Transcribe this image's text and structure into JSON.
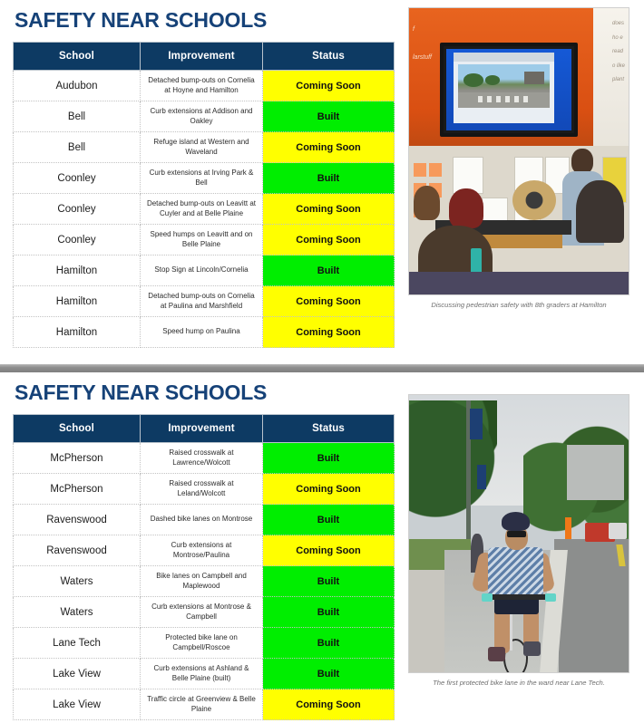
{
  "sections": [
    {
      "title": "SAFETY NEAR SCHOOLS",
      "columns": [
        "School",
        "Improvement",
        "Status"
      ],
      "rows": [
        {
          "school": "Audubon",
          "improvement": "Detached bump-outs on Cornelia at Hoyne and Hamilton",
          "status": "Coming Soon",
          "state": "soon"
        },
        {
          "school": "Bell",
          "improvement": "Curb extensions at Addison and Oakley",
          "status": "Built",
          "state": "built"
        },
        {
          "school": "Bell",
          "improvement": "Refuge island at Western and Waveland",
          "status": "Coming Soon",
          "state": "soon"
        },
        {
          "school": "Coonley",
          "improvement": "Curb extensions at Irving Park & Bell",
          "status": "Built",
          "state": "built"
        },
        {
          "school": "Coonley",
          "improvement": "Detached bump-outs on Leavitt at Cuyler and at Belle Plaine",
          "status": "Coming Soon",
          "state": "soon"
        },
        {
          "school": "Coonley",
          "improvement": "Speed humps on Leavitt and on Belle Plaine",
          "status": "Coming Soon",
          "state": "soon"
        },
        {
          "school": "Hamilton",
          "improvement": "Stop Sign at Lincoln/Cornelia",
          "status": "Built",
          "state": "built"
        },
        {
          "school": "Hamilton",
          "improvement": "Detached bump-outs on Cornelia at Paulina and Marshfield",
          "status": "Coming Soon",
          "state": "soon"
        },
        {
          "school": "Hamilton",
          "improvement": "Speed hump on Paulina",
          "status": "Coming Soon",
          "state": "soon"
        }
      ],
      "photo": {
        "name": "classroom-presentation-photo",
        "caption": "Discussing pedestrian safety with 8th graders at Hamilton",
        "wall_text_left": "f\nlarstuff",
        "wall_text_right": "does\nho e\nread\no like\nplant"
      }
    },
    {
      "title": "SAFETY NEAR SCHOOLS",
      "columns": [
        "School",
        "Improvement",
        "Status"
      ],
      "rows": [
        {
          "school": "McPherson",
          "improvement": "Raised crosswalk at Lawrence/Wolcott",
          "status": "Built",
          "state": "built"
        },
        {
          "school": "McPherson",
          "improvement": "Raised crosswalk at Leland/Wolcott",
          "status": "Coming Soon",
          "state": "soon"
        },
        {
          "school": "Ravenswood",
          "improvement": "Dashed bike lanes on Montrose",
          "status": "Built",
          "state": "built"
        },
        {
          "school": "Ravenswood",
          "improvement": "Curb extensions at Montrose/Paulina",
          "status": "Coming Soon",
          "state": "soon"
        },
        {
          "school": "Waters",
          "improvement": "Bike lanes on Campbell and Maplewood",
          "status": "Built",
          "state": "built"
        },
        {
          "school": "Waters",
          "improvement": "Curb extensions at Montrose & Campbell",
          "status": "Built",
          "state": "built"
        },
        {
          "school": "Lane Tech",
          "improvement": "Protected bike lane on Campbell/Roscoe",
          "status": "Built",
          "state": "built"
        },
        {
          "school": "Lake View",
          "improvement": "Curb extensions at Ashland & Belle Plaine (built)",
          "status": "Built",
          "state": "built"
        },
        {
          "school": "Lake View",
          "improvement": "Traffic circle at Greenview & Belle Plaine",
          "status": "Coming Soon",
          "state": "soon"
        }
      ],
      "photo": {
        "name": "protected-bike-lane-photo",
        "caption": "The first protected bike lane in the ward near Lane Tech."
      }
    }
  ],
  "colors": {
    "title": "#164278",
    "header_bg": "#0d3a63",
    "built": "#00ee00",
    "coming_soon": "#ffff00",
    "divider": "#8e8e8e"
  }
}
